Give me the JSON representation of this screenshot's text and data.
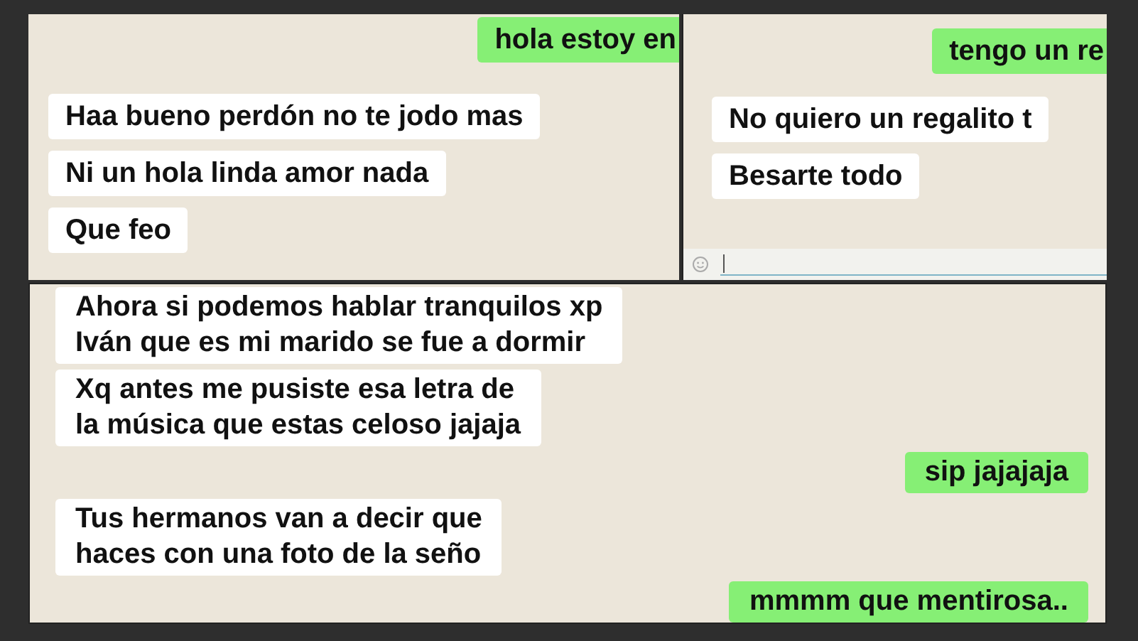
{
  "panels": [
    {
      "messages": [
        {
          "kind": "sent",
          "lines": [
            "hola estoy en"
          ]
        },
        {
          "kind": "received",
          "lines": [
            "Haa bueno perdón no te jodo mas"
          ]
        },
        {
          "kind": "received",
          "lines": [
            "Ni un hola linda amor nada"
          ]
        },
        {
          "kind": "received",
          "lines": [
            "Que feo"
          ]
        }
      ]
    },
    {
      "messages": [
        {
          "kind": "sent",
          "lines": [
            "tengo un re"
          ]
        },
        {
          "kind": "received",
          "lines": [
            "No quiero un regalito t"
          ]
        },
        {
          "kind": "received",
          "lines": [
            "Besarte todo"
          ]
        }
      ],
      "input": {
        "kind": "compose"
      }
    },
    {
      "messages": [
        {
          "kind": "received",
          "lines": [
            "Ahora si podemos hablar tranquilos xp",
            "Iván que es mi marido se fue a dormir"
          ]
        },
        {
          "kind": "received",
          "lines": [
            "Xq antes me pusiste esa letra de",
            "la música que estas celoso jajaja"
          ]
        },
        {
          "kind": "sent",
          "lines": [
            "sip jajajaja"
          ]
        },
        {
          "kind": "received",
          "lines": [
            "Tus hermanos van a decir que",
            "haces con una foto de la seño"
          ]
        },
        {
          "kind": "sent",
          "lines": [
            "mmmm que mentirosa.."
          ]
        }
      ]
    }
  ]
}
